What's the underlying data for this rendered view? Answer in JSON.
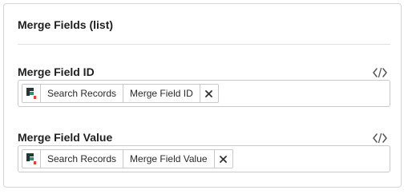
{
  "panel": {
    "title": "Merge Fields (list)"
  },
  "fields": [
    {
      "label": "Merge Field ID",
      "code_icon": "code-brackets-icon",
      "token": {
        "source_icon": "app-logo-icon",
        "source": "Search Records",
        "field": "Merge Field ID",
        "remove_icon": "close-icon"
      }
    },
    {
      "label": "Merge Field Value",
      "code_icon": "code-brackets-icon",
      "token": {
        "source_icon": "app-logo-icon",
        "source": "Search Records",
        "field": "Merge Field Value",
        "remove_icon": "close-icon"
      }
    }
  ],
  "colors": {
    "logo_dark": "#1d3b34",
    "logo_green": "#3a8a6e",
    "logo_red": "#e0442d"
  }
}
